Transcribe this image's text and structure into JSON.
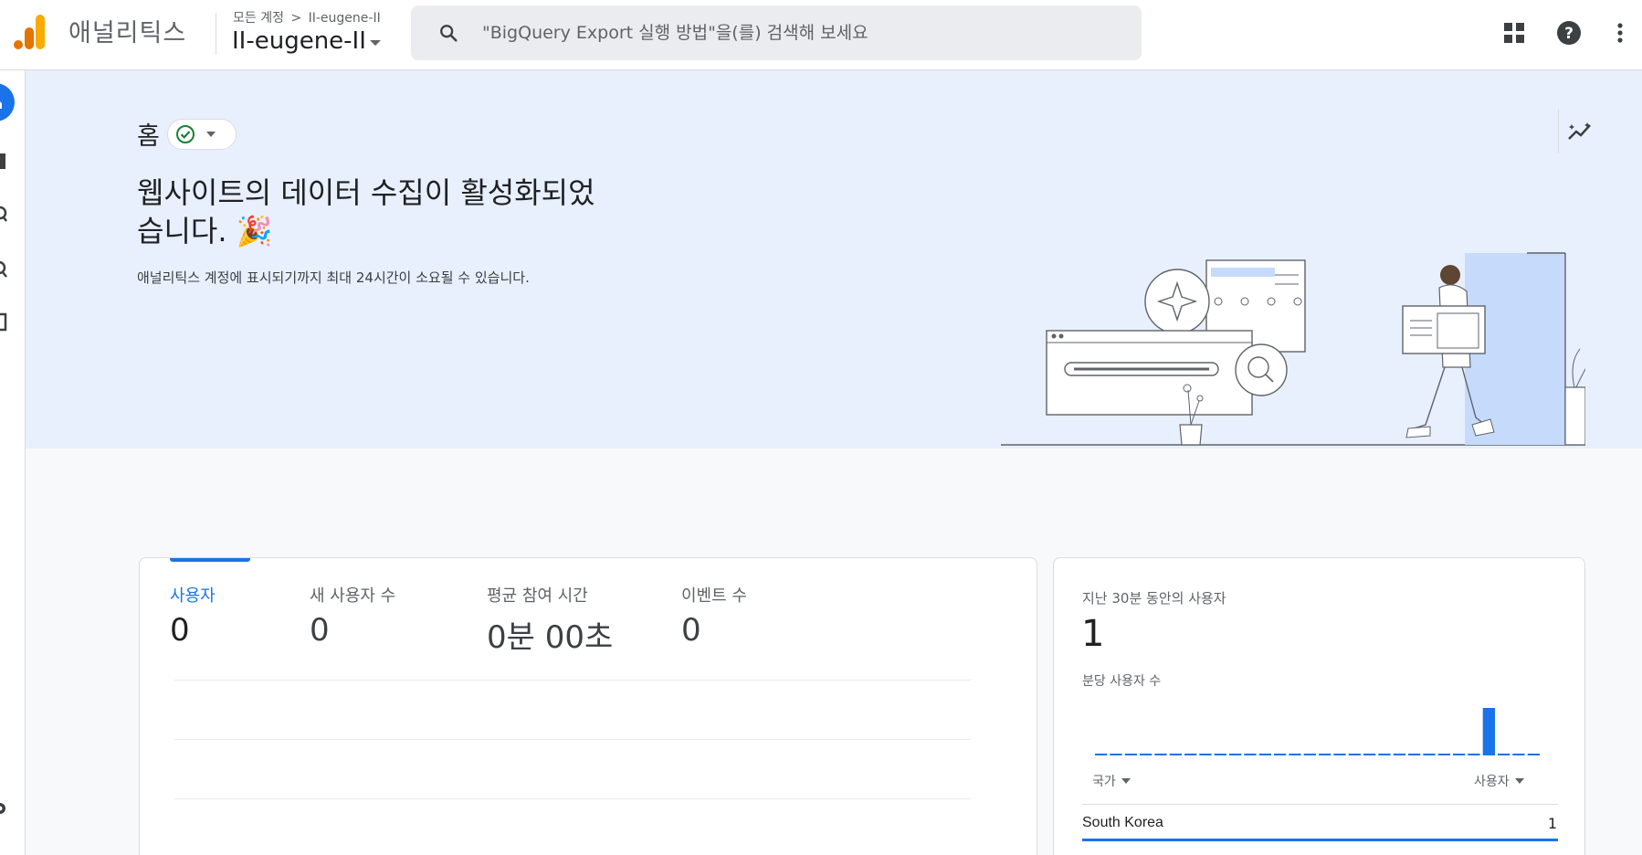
{
  "app": {
    "name": "애널리틱스",
    "breadcrumb_root": "모든 계정",
    "breadcrumb_sep": ">",
    "breadcrumb_account": "II-eugene-II",
    "account_name": "II-eugene-II"
  },
  "search": {
    "placeholder": "\"BigQuery Export 실행 방법\"을(를) 검색해 보세요"
  },
  "header_icons": [
    "apps-grid-icon",
    "help-icon",
    "more-vert-icon"
  ],
  "rail_icons": [
    "home-icon",
    "reports-icon",
    "explore-icon",
    "advertising-icon",
    "configure-icon",
    "admin-gear-icon"
  ],
  "hero": {
    "title": "홈",
    "status": "active-check",
    "headline": "웹사이트의 데이터 수집이 활성화되었습니다. 🎉",
    "subtext": "애널리틱스 계정에 표시되기까지 최대 24시간이 소요될 수 있습니다."
  },
  "metrics": [
    {
      "label": "사용자",
      "value": "0"
    },
    {
      "label": "새 사용자 수",
      "value": "0"
    },
    {
      "label": "평균 참여 시간",
      "value": "0분 00초"
    },
    {
      "label": "이벤트 수",
      "value": "0"
    }
  ],
  "realtime": {
    "label": "지난 30분 동안의 사용자",
    "value": "1",
    "per_minute_label": "분당 사용자 수",
    "per_minute_values": [
      0,
      0,
      0,
      0,
      0,
      0,
      0,
      0,
      0,
      0,
      0,
      0,
      0,
      0,
      0,
      0,
      0,
      0,
      0,
      0,
      0,
      0,
      0,
      0,
      0,
      0,
      1,
      0,
      0,
      0
    ],
    "col_country": "국가",
    "col_users": "사용자",
    "rows": [
      {
        "country": "South Korea",
        "users": "1"
      }
    ]
  },
  "colors": {
    "accent": "#1a73e8",
    "hero_bg": "#e8f0fe",
    "status_green": "#188038",
    "logo_orange": "#f9ab00",
    "logo_dark_orange": "#e37400"
  }
}
